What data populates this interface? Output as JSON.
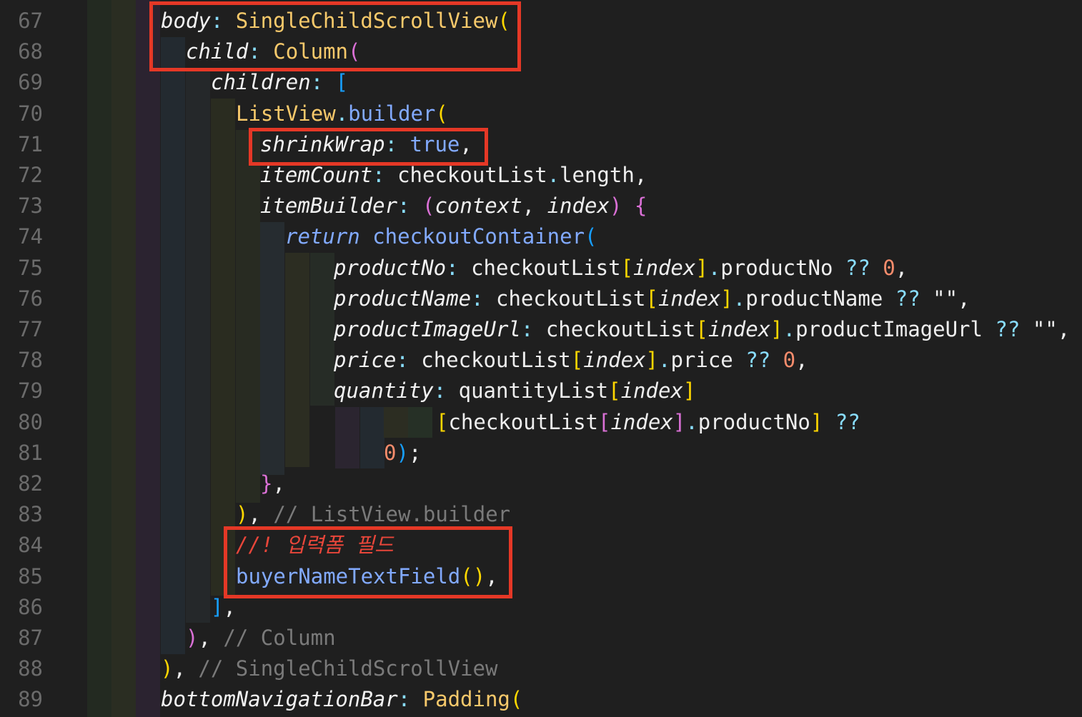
{
  "editor": {
    "lines": [
      {
        "num": "67",
        "indent": 225,
        "tokens": [
          [
            "body",
            "prop"
          ],
          [
            ": ",
            "punc"
          ],
          [
            "SingleChildScrollView",
            "cls"
          ],
          [
            "(",
            "br"
          ]
        ]
      },
      {
        "num": "68",
        "indent": 260,
        "tokens": [
          [
            "child",
            "prop"
          ],
          [
            ": ",
            "punc"
          ],
          [
            "Column",
            "cls"
          ],
          [
            "(",
            "br2"
          ]
        ]
      },
      {
        "num": "69",
        "indent": 295,
        "tokens": [
          [
            "children",
            "prop"
          ],
          [
            ": ",
            "punc"
          ],
          [
            "[",
            "br3"
          ]
        ]
      },
      {
        "num": "70",
        "indent": 330,
        "tokens": [
          [
            "ListView",
            "cls"
          ],
          [
            ".",
            "punc"
          ],
          [
            "builder",
            "fn"
          ],
          [
            "(",
            "br"
          ]
        ]
      },
      {
        "num": "71",
        "indent": 364,
        "tokens": [
          [
            "shrinkWrap",
            "prop"
          ],
          [
            ": ",
            "punc"
          ],
          [
            "true",
            "kwb"
          ],
          [
            ",",
            "plain"
          ]
        ]
      },
      {
        "num": "72",
        "indent": 364,
        "tokens": [
          [
            "itemCount",
            "prop"
          ],
          [
            ": ",
            "punc"
          ],
          [
            "checkoutList",
            "plain"
          ],
          [
            ".",
            "punc"
          ],
          [
            "length",
            "plain"
          ],
          [
            ",",
            "plain"
          ]
        ]
      },
      {
        "num": "73",
        "indent": 364,
        "tokens": [
          [
            "itemBuilder",
            "prop"
          ],
          [
            ": ",
            "punc"
          ],
          [
            "(",
            "br2"
          ],
          [
            "context",
            "ital"
          ],
          [
            ", ",
            "plain"
          ],
          [
            "index",
            "ital"
          ],
          [
            ") ",
            "br2"
          ],
          [
            "{",
            "br2"
          ]
        ]
      },
      {
        "num": "74",
        "indent": 399,
        "tokens": [
          [
            "return ",
            "kw"
          ],
          [
            "checkoutContainer",
            "fn"
          ],
          [
            "(",
            "br3"
          ]
        ]
      },
      {
        "num": "75",
        "indent": 467,
        "tokens": [
          [
            "productNo",
            "prop"
          ],
          [
            ": ",
            "punc"
          ],
          [
            "checkoutList",
            "plain"
          ],
          [
            "[",
            "br"
          ],
          [
            "index",
            "ital"
          ],
          [
            "]",
            "br"
          ],
          [
            ".",
            "punc"
          ],
          [
            "productNo ",
            "plain"
          ],
          [
            "?? ",
            "punc"
          ],
          [
            "0",
            "num"
          ],
          [
            ",",
            "plain"
          ]
        ]
      },
      {
        "num": "76",
        "indent": 467,
        "tokens": [
          [
            "productName",
            "prop"
          ],
          [
            ": ",
            "punc"
          ],
          [
            "checkoutList",
            "plain"
          ],
          [
            "[",
            "br"
          ],
          [
            "index",
            "ital"
          ],
          [
            "]",
            "br"
          ],
          [
            ".",
            "punc"
          ],
          [
            "productName ",
            "plain"
          ],
          [
            "?? ",
            "punc"
          ],
          [
            "\"\"",
            "plain"
          ],
          [
            ",",
            "plain"
          ]
        ]
      },
      {
        "num": "77",
        "indent": 467,
        "tokens": [
          [
            "productImageUrl",
            "prop"
          ],
          [
            ": ",
            "punc"
          ],
          [
            "checkoutList",
            "plain"
          ],
          [
            "[",
            "br"
          ],
          [
            "index",
            "ital"
          ],
          [
            "]",
            "br"
          ],
          [
            ".",
            "punc"
          ],
          [
            "productImageUrl ",
            "plain"
          ],
          [
            "?? ",
            "punc"
          ],
          [
            "\"\"",
            "plain"
          ],
          [
            ",",
            "plain"
          ]
        ]
      },
      {
        "num": "78",
        "indent": 467,
        "tokens": [
          [
            "price",
            "prop"
          ],
          [
            ": ",
            "punc"
          ],
          [
            "checkoutList",
            "plain"
          ],
          [
            "[",
            "br"
          ],
          [
            "index",
            "ital"
          ],
          [
            "]",
            "br"
          ],
          [
            ".",
            "punc"
          ],
          [
            "price ",
            "plain"
          ],
          [
            "?? ",
            "punc"
          ],
          [
            "0",
            "num"
          ],
          [
            ",",
            "plain"
          ]
        ]
      },
      {
        "num": "79",
        "indent": 467,
        "tokens": [
          [
            "quantity",
            "prop"
          ],
          [
            ": ",
            "punc"
          ],
          [
            "quantityList",
            "plain"
          ],
          [
            "[",
            "br"
          ],
          [
            "index",
            "ital"
          ],
          [
            "]",
            "br"
          ]
        ]
      },
      {
        "num": "80",
        "indent": 610,
        "tokens": [
          [
            "[",
            "br"
          ],
          [
            "checkoutList",
            "plain"
          ],
          [
            "[",
            "br2"
          ],
          [
            "index",
            "ital"
          ],
          [
            "]",
            "br2"
          ],
          [
            ".",
            "punc"
          ],
          [
            "productNo",
            "plain"
          ],
          [
            "] ",
            "br"
          ],
          [
            "??",
            "punc"
          ]
        ]
      },
      {
        "num": "81",
        "indent": 537,
        "tokens": [
          [
            "0",
            "num"
          ],
          [
            ")",
            "br3"
          ],
          [
            ";",
            "plain"
          ]
        ]
      },
      {
        "num": "82",
        "indent": 364,
        "tokens": [
          [
            "}",
            "br2"
          ],
          [
            ",",
            "plain"
          ]
        ]
      },
      {
        "num": "83",
        "indent": 330,
        "tokens": [
          [
            ")",
            "br"
          ],
          [
            ", ",
            "plain"
          ],
          [
            "// ListView.builder",
            "cmt"
          ]
        ]
      },
      {
        "num": "84",
        "indent": 330,
        "tokens": [
          [
            "//! 입력폼 필드",
            "redcmt"
          ]
        ]
      },
      {
        "num": "85",
        "indent": 330,
        "tokens": [
          [
            "buyerNameTextField",
            "fn"
          ],
          [
            "()",
            "br"
          ],
          [
            ",",
            "plain"
          ]
        ]
      },
      {
        "num": "86",
        "indent": 295,
        "tokens": [
          [
            "]",
            "br3"
          ],
          [
            ",",
            "plain"
          ]
        ]
      },
      {
        "num": "87",
        "indent": 260,
        "tokens": [
          [
            ")",
            "br2"
          ],
          [
            ", ",
            "plain"
          ],
          [
            "// Column",
            "cmt"
          ]
        ]
      },
      {
        "num": "88",
        "indent": 225,
        "tokens": [
          [
            ")",
            "br"
          ],
          [
            ", ",
            "plain"
          ],
          [
            "// SingleChildScrollView",
            "cmt"
          ]
        ]
      },
      {
        "num": "89",
        "indent": 225,
        "tokens": [
          [
            "bottomNavigationBar",
            "prop"
          ],
          [
            ": ",
            "punc"
          ],
          [
            "Padding",
            "cls"
          ],
          [
            "(",
            "br"
          ]
        ]
      }
    ]
  },
  "colors": {
    "background": "#1f1f1f",
    "highlight_box": "#e53826"
  }
}
